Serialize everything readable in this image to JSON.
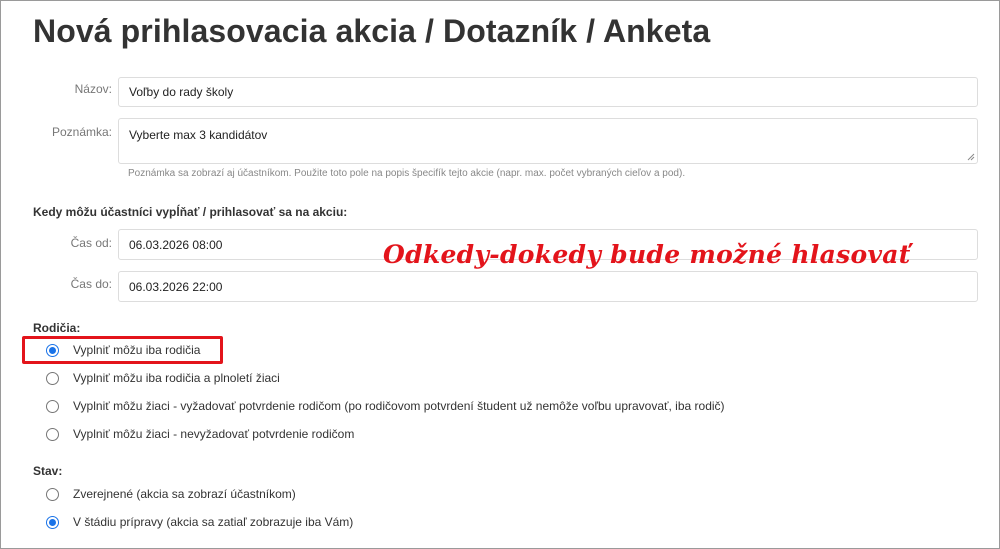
{
  "page_title": "Nová prihlasovacia akcia / Dotazník / Anketa",
  "form": {
    "name": {
      "label": "Názov:",
      "value": "Voľby do rady školy"
    },
    "note": {
      "label": "Poznámka:",
      "value": "Vyberte max 3 kandidátov",
      "help": "Poznámka sa zobrazí aj účastníkom. Použite toto pole na popis špecifík tejto akcie (napr. max. počet vybraných cieľov a pod)."
    },
    "schedule": {
      "heading": "Kedy môžu účastníci vypĺňať / prihlasovať sa na akciu:",
      "from": {
        "label": "Čas od:",
        "value": "06.03.2026 08:00"
      },
      "to": {
        "label": "Čas do:",
        "value": "06.03.2026 22:00"
      }
    },
    "parents": {
      "heading": "Rodičia:",
      "options": [
        {
          "label": "Vyplniť môžu iba rodičia",
          "checked": true
        },
        {
          "label": "Vyplniť môžu iba rodičia a plnoletí žiaci",
          "checked": false
        },
        {
          "label": "Vyplniť môžu žiaci - vyžadovať potvrdenie rodičom (po rodičovom potvrdení študent už nemôže voľbu upravovať, iba rodič)",
          "checked": false
        },
        {
          "label": "Vyplniť môžu žiaci - nevyžadovať potvrdenie rodičom",
          "checked": false
        }
      ]
    },
    "status": {
      "heading": "Stav:",
      "options": [
        {
          "label": "Zverejnené (akcia sa zobrazí účastníkom)",
          "checked": false
        },
        {
          "label": "V štádiu prípravy (akcia sa zatiaľ zobrazuje iba Vám)",
          "checked": true
        }
      ]
    }
  },
  "annotation": {
    "text": "Odkedy-dokedy bude možné hlasovať",
    "color": "#e3141b"
  },
  "colors": {
    "accent": "#1a73e8",
    "highlight": "#e3141b"
  }
}
